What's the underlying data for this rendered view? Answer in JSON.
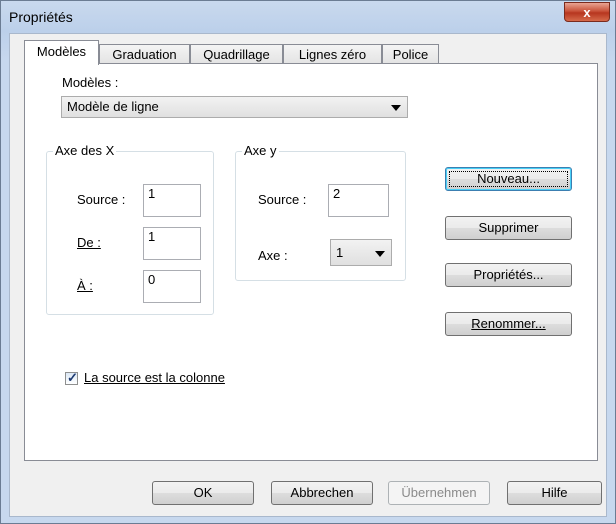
{
  "window": {
    "title": "Propriétés",
    "close_glyph": "x"
  },
  "tabs": [
    {
      "label": "Modèles",
      "active": true
    },
    {
      "label": "Graduation",
      "active": false
    },
    {
      "label": "Quadrillage",
      "active": false
    },
    {
      "label": "Lignes zéro",
      "active": false
    },
    {
      "label": "Police",
      "active": false
    }
  ],
  "models": {
    "label": "Modèles :",
    "selected": "Modèle de ligne"
  },
  "axis_x": {
    "title": "Axe des X",
    "source_label": "Source :",
    "source_value": "1",
    "from_label": "De :",
    "from_value": "1",
    "to_label": "À :",
    "to_value": "0"
  },
  "axis_y": {
    "title": "Axe y",
    "source_label": "Source :",
    "source_value": "2",
    "axis_label": "Axe :",
    "axis_value": "1"
  },
  "checkbox": {
    "label": "La source est la colonne",
    "checked": true
  },
  "side_buttons": {
    "new": "Nouveau...",
    "delete": "Supprimer",
    "properties": "Propriétés...",
    "rename": "Renommer..."
  },
  "footer": {
    "ok": "OK",
    "cancel": "Abbrechen",
    "apply": "Übernehmen",
    "help": "Hilfe"
  }
}
